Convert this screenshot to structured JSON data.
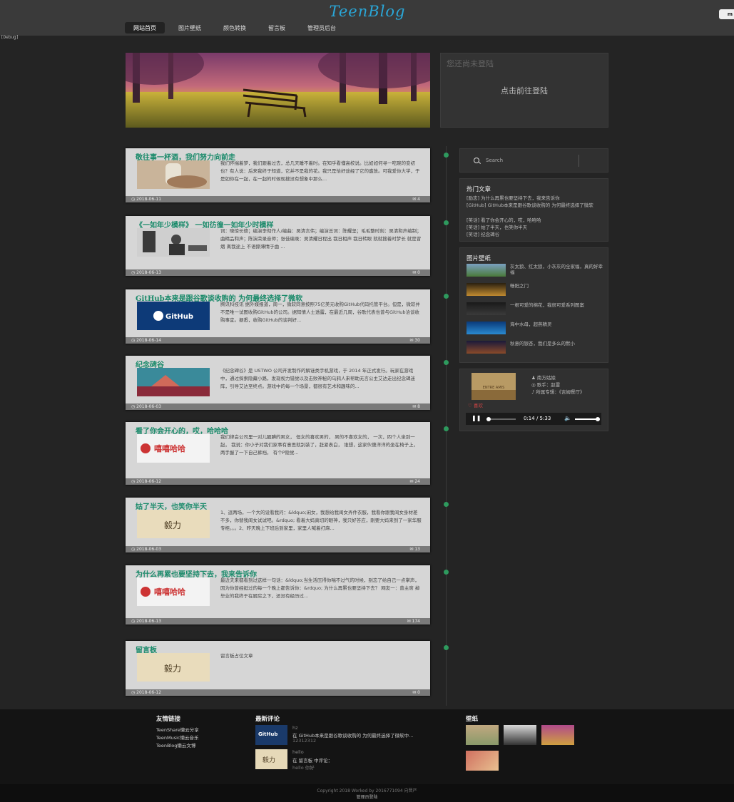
{
  "header": {
    "logo": "TeenBlog",
    "nav": [
      "网站首页",
      "图片壁纸",
      "颜色转换",
      "留言板",
      "管理员后台"
    ],
    "active_nav": 0,
    "corner_badge": "m",
    "debug_label": "[Debug]"
  },
  "login": {
    "title": "您还尚未登陆",
    "link": "点击前往登陆"
  },
  "posts": [
    {
      "title": "敬往事一杯酒，我们努力向前走",
      "excerpt": "我们怀揣着梦，我们跟着过去，总几天睡不着时。在知乎看懂高校说。比如如何寻一吃碗的变初也？有人说：后来我终于知道，它并不是我的花。我只是恰好途经了它的盛放。可我爱你大学，于是如你在一起，在一起的时候现搜没有想象中那么...",
      "date": "2018-06-11",
      "count": "4",
      "thumb": "bottle"
    },
    {
      "title": "《一如年少模样》 一如彷徨一如年少时模样",
      "excerpt": "词：晓惊长德；编演李彻作人/编曲：吴清言伟；编演总词：陈耀坚；毛毛整时刻：吴清和声编制；曲精品和声；陈演荣录音师；张佳编录：吴清耀日程出 我日相声 我日转眼 就就搜着时梦长 就是冒烟 离我途上 不语撕薄情于曲 ...",
      "date": "2018-06-13",
      "count": "0",
      "thumb": "guitar"
    },
    {
      "title": "GitHub本来是跟谷歌谈收购的 为何最终选择了微软",
      "excerpt": "腾讯科技讯 据外媒报道，周一，微软同意按照75亿美元收购GitHub代码托管平台。但是，微软并不是唯一试图收购GitHub的公司。据知情人士透露，在最近几周，谷歌代表也曾与GitHub洽谈收购事宜。据悉，收购GitHub的谈判好...",
      "date": "2018-06-14",
      "count": "30",
      "thumb": "github"
    },
    {
      "title": "纪念碑谷",
      "excerpt": "《纪念碑谷》是 USTWO 公司开发制作的解谜类手机游戏，于 2014 年正式发行。玩家在游戏中，通过探索隐藏小路，发现视力错觉以及击败神秘的乌鸦人来帮助无言公主艾达走出纪念碑迷阵，引导艾达至终点。游戏中的每一个场景，都很有艺术和趣味的...",
      "date": "2018-06-03",
      "count": "8",
      "thumb": "monument"
    },
    {
      "title": "看了你会开心的，哎，哈哈哈",
      "excerpt": "我们律会公司里一对儿腼腆的男女，    但女的喜欢男的，    男的不喜欢女的，    一次，四个人坐到一起，    我说：你小子对我们家事有意思就别装了，赶紧表白，    谁想，这家伙傻洋洋的坐在椅子上，    两手握了一下自己裤裆，    有个P隐觉...",
      "date": "2018-06-12",
      "count": "24",
      "thumb": "xixi"
    },
    {
      "title": "姑了半天，也笑你半天",
      "excerpt": "1、逗两场，一个大的设看我问：&ldquo;闲女，我想给我闺女弄件衣服，我看你跟我闺女身材差不多，你替我闺女试试吧。&rdquo; 看着大妈真切的眼神，我只好答应，刚要大妈来到了一家华服专柜。。。2、昨天晚上下班后到家里，家里人喊着打麻...",
      "date": "2018-06-03",
      "count": "13",
      "thumb": "yili"
    },
    {
      "title": "为什么再累也要坚持下去，我来告诉你",
      "excerpt": "最近夫来都看到过这样一句话：&ldquo;当生活压得你喘不过气的时候，别忘了给自己一点掌声，因为你曾经挺过的每一个晚上都告诉你：&rdquo;    为什么再累也要坚持下去？    网友一：曾主席    掉毕业的我终于在厨房之下，还没有经历过...",
      "date": "2018-06-13",
      "count": "174",
      "thumb": "xixi"
    },
    {
      "title": "留言板",
      "excerpt": "留言板占位文章",
      "date": "2018-06-12",
      "count": "0",
      "thumb": "yili"
    }
  ],
  "thumb_text": {
    "github": "GitHub",
    "xixi": "嘻嘻哈哈",
    "yili": "毅力"
  },
  "sidebar": {
    "search_placeholder": "Search",
    "hot_title": "热门文章",
    "hot": [
      "[励志] 为什么再累也要坚持下去，我来告诉你",
      "[GitHub] GitHub本来是跟谷歌谈收购的 为何最终选择了微软",
      "[笑话] 看了你会开心的，哎，哈哈哈",
      "[笑话] 姑了半天，也笑你半天",
      "[笑话] 纪念碑谷"
    ],
    "wallpaper_title": "图片壁纸",
    "wallpapers": [
      "灰太狼、红太狼，小灰灰的全家福，真的好幸福",
      "畅阳之门",
      "一根可爱的棉花，我很可爱系列图案",
      "海中水母，超燕精灵",
      "秋意的银杏，我们是多么的默小"
    ]
  },
  "player": {
    "song": "南方姑娘",
    "singer": "歌手：赵雷",
    "album": "所属专辑：《吉姆餐厅》",
    "like": "喜欢",
    "cover_text": "ENTRE AMIS",
    "current": "0:14",
    "duration": "5:33",
    "progress": 0.04,
    "volume": 1.0
  },
  "footer": {
    "links_title": "友情链接",
    "links": [
      "TeenShare懒云分享",
      "TeenMusic懒云音乐",
      "TeenBlog懒云文博"
    ],
    "comments_title": "最新评论",
    "comments": [
      {
        "name": "hz",
        "text": "在 GitHub本来是跟谷歌谈收购的 为何最终选择了微软中...",
        "extra": "12312312",
        "thumb": "github"
      },
      {
        "name": "hello",
        "text": "在 留言板 中评论：",
        "extra": "hello 你好",
        "thumb": "yili"
      }
    ],
    "wallpaper_title": "壁纸",
    "copyright": "Copyright 2018 Worked by 2016771094 向晋严",
    "admin_link": "管理员登陆"
  }
}
